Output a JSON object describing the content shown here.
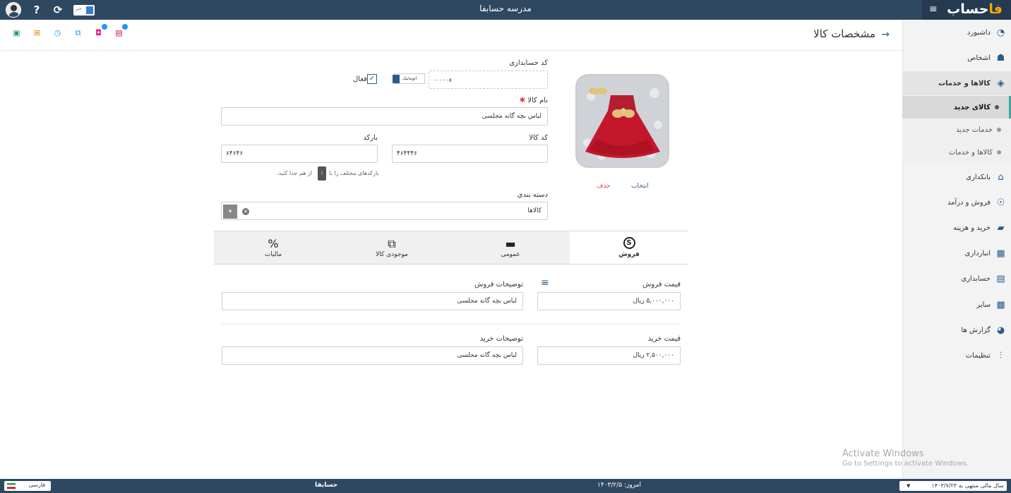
{
  "topbar": {
    "title": "مدرسه حسابفا",
    "brand": "حساب",
    "brand_accent": "فا",
    "news_label": "خبر"
  },
  "header": {
    "title": "مشخصات کالا",
    "back_icon": "arrow-right-icon",
    "icons": [
      "save-icon",
      "add-file-icon",
      "history-icon",
      "copy-icon",
      "gift-icon",
      "chat-icon"
    ]
  },
  "sidebar": {
    "items": [
      {
        "label": "داشبورد",
        "icon": "dashboard-icon"
      },
      {
        "label": "اشخاص",
        "icon": "people-icon"
      },
      {
        "label": "کالاها و خدمات",
        "icon": "box-icon"
      },
      {
        "label": "بانکداری",
        "icon": "bank-icon"
      },
      {
        "label": "فروش و درآمد",
        "icon": "sales-icon"
      },
      {
        "label": "خرید و هزینه",
        "icon": "wallet-icon"
      },
      {
        "label": "انبارداری",
        "icon": "warehouse-icon"
      },
      {
        "label": "حسابداری",
        "icon": "ledger-icon"
      },
      {
        "label": "سایر",
        "icon": "misc-icon"
      },
      {
        "label": "گزارش ها",
        "icon": "report-icon"
      },
      {
        "label": "تنظیمات",
        "icon": "settings-icon"
      }
    ],
    "subitems": [
      {
        "label": "کالای جدید"
      },
      {
        "label": "خدمات جدید"
      },
      {
        "label": "کالاها و خدمات"
      }
    ]
  },
  "form": {
    "accounting_code_label": "کد حسابداری",
    "accounting_code_value": "۰۰۰۰۰۸",
    "auto_label": "اتوماتیک",
    "active_label": "فعال",
    "name_label": "نام کالا",
    "name_value": "لباس بچه گانه مجلسی",
    "code_label": "کد کالا",
    "code_value": "۴۶۴۴۴۶",
    "barcode_label": "بارکد",
    "barcode_value": "۶۴۶۴۶",
    "barcode_help_1": "بارکدهای مختلف را با",
    "barcode_help_2": "از هم جدا کنید.",
    "category_label": "دسته بندی",
    "category_value": "کالاها",
    "photo_select": "انتخاب",
    "photo_delete": "حذف"
  },
  "tabs": [
    {
      "label": "فروش",
      "icon": "S"
    },
    {
      "label": "عمومی",
      "icon": "▬"
    },
    {
      "label": "موجودی کالا",
      "icon": "⧉"
    },
    {
      "label": "مالیات",
      "icon": "%"
    }
  ],
  "sales": {
    "price_label": "قیمت فروش",
    "price_value": "۵,۰۰۰,۰۰۰ ریال",
    "desc_label": "توضیحات فروش",
    "desc_value": "لباس بچه گانه مجلسی"
  },
  "purchase": {
    "price_label": "قیمت خرید",
    "price_value": "۲,۵۰۰,۰۰۰ ریال",
    "desc_label": "توضیحات خرید",
    "desc_value": "لباس بچه گانه مجلسی"
  },
  "statusbar": {
    "language": "فارسی",
    "brand": "حسابفا",
    "today": "امروز: ۱۴۰۳/۲/۵",
    "fiscal_year": "سال مالی منتهی به ۱۴۰۳/۷/۲۳"
  },
  "watermark": {
    "line1": "Activate Windows",
    "line2": "Go to Settings to activate Windows."
  },
  "colors": {
    "topbar": "#2f4862",
    "accent": "#2a5b8c",
    "active_tab_marker": "#3aa89a"
  }
}
